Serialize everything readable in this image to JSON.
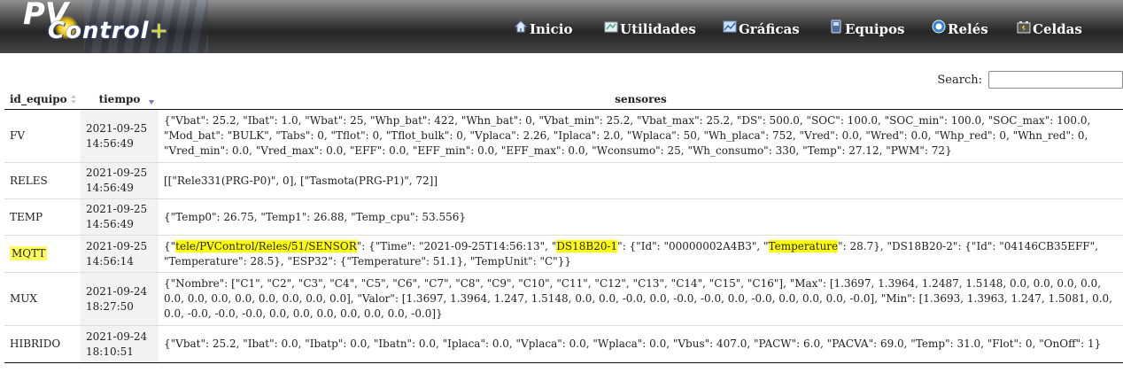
{
  "header": {
    "logo_pv": "PV",
    "logo_control": "Control",
    "logo_plus": "+",
    "nav": [
      {
        "label": "Inicio",
        "icon": "home-icon"
      },
      {
        "label": "Utilidades",
        "icon": "utilities-icon"
      },
      {
        "label": "Gráficas",
        "icon": "chart-icon"
      },
      {
        "label": "Equipos",
        "icon": "device-icon"
      },
      {
        "label": "Relés",
        "icon": "relay-icon"
      },
      {
        "label": "Celdas",
        "icon": "battery-icon"
      }
    ]
  },
  "search": {
    "label": "Search:",
    "value": ""
  },
  "table": {
    "headers": [
      "id_equipo",
      "tiempo",
      "sensores"
    ],
    "rows": [
      {
        "id": "FV",
        "date": "2021-09-25",
        "time": "14:56:49",
        "sensores": "{\"Vbat\": 25.2, \"Ibat\": 1.0, \"Wbat\": 25, \"Whp_bat\": 422, \"Whn_bat\": 0, \"Vbat_min\": 25.2, \"Vbat_max\": 25.2, \"DS\": 500.0, \"SOC\": 100.0, \"SOC_min\": 100.0, \"SOC_max\": 100.0, \"Mod_bat\": \"BULK\", \"Tabs\": 0, \"Tflot\": 0, \"Tflot_bulk\": 0, \"Vplaca\": 2.26, \"Iplaca\": 2.0, \"Wplaca\": 50, \"Wh_placa\": 752, \"Vred\": 0.0, \"Wred\": 0.0, \"Whp_red\": 0, \"Whn_red\": 0, \"Vred_min\": 0.0, \"Vred_max\": 0.0, \"EFF\": 0.0, \"EFF_min\": 0.0, \"EFF_max\": 0.0, \"Wconsumo\": 25, \"Wh_consumo\": 330, \"Temp\": 27.12, \"PWM\": 72}"
      },
      {
        "id": "RELES",
        "date": "2021-09-25",
        "time": "14:56:49",
        "sensores": "[[\"Rele331(PRG-P0)\", 0], [\"Tasmota(PRG-P1)\", 72]]"
      },
      {
        "id": "TEMP",
        "date": "2021-09-25",
        "time": "14:56:49",
        "sensores": "{\"Temp0\": 26.75, \"Temp1\": 26.88, \"Temp_cpu\": 53.556}"
      },
      {
        "id": "MQTT",
        "date": "2021-09-25",
        "time": "14:56:14",
        "s_open": "{\"",
        "s_topic": "tele/PVControl/Reles/51/SENSOR",
        "s_mid1": "\": {\"Time\": \"2021-09-25T14:56:13\", \"",
        "s_sensor": "DS18B20-1",
        "s_mid2": "\": {\"Id\": \"00000002A4B3\", \"",
        "s_temp": "Temperature",
        "s_rest": "\": 28.7}, \"DS18B20-2\": {\"Id\": \"04146CB35EFF\", \"Temperature\": 28.5}, \"ESP32\": {\"Temperature\": 51.1}, \"TempUnit\": \"C\"}}"
      },
      {
        "id": "MUX",
        "date": "2021-09-24",
        "time": "18:27:50",
        "sensores": "{\"Nombre\": [\"C1\", \"C2\", \"C3\", \"C4\", \"C5\", \"C6\", \"C7\", \"C8\", \"C9\", \"C10\", \"C11\", \"C12\", \"C13\", \"C14\", \"C15\", \"C16\"], \"Max\": [1.3697, 1.3964, 1.2487, 1.5148, 0.0, 0.0, 0.0, 0.0, 0.0, 0.0, 0.0, 0.0, 0.0, 0.0, 0.0, 0.0], \"Valor\": [1.3697, 1.3964, 1.247, 1.5148, 0.0, 0.0, -0.0, 0.0, -0.0, -0.0, 0.0, -0.0, 0.0, 0.0, 0.0, -0.0], \"Min\": [1.3693, 1.3963, 1.247, 1.5081, 0.0, 0.0, -0.0, -0.0, -0.0, 0.0, 0.0, 0.0, 0.0, 0.0, 0.0, -0.0]}"
      },
      {
        "id": "HIBRIDO",
        "date": "2021-09-24",
        "time": "18:10:51",
        "sensores": "{\"Vbat\": 25.2, \"Ibat\": 0.0, \"Ibatp\": 0.0, \"Ibatn\": 0.0, \"Iplaca\": 0.0, \"Vplaca\": 0.0, \"Wplaca\": 0.0, \"Vbus\": 407.0, \"PACW\": 6.0, \"PACVA\": 69.0, \"Temp\": 31.0, \"Flot\": 0, \"OnOff\": 1}"
      }
    ]
  },
  "colors": {
    "highlight": "#ffff00",
    "header_dark": "#262626",
    "time_cell_bg": "#f2f2f2"
  }
}
